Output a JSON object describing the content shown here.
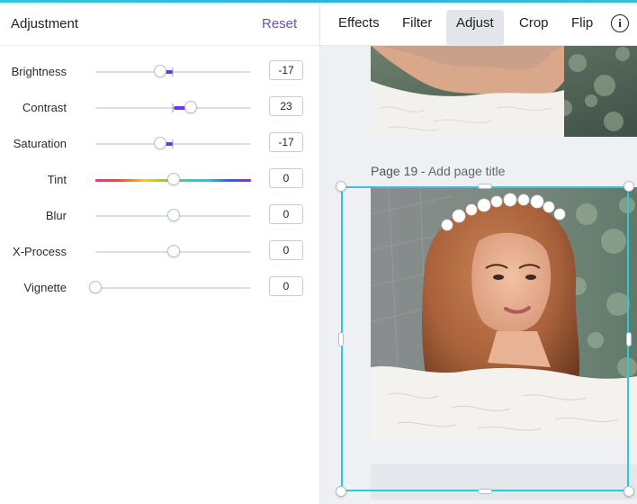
{
  "panel": {
    "title": "Adjustment",
    "reset_label": "Reset"
  },
  "adjustments": [
    {
      "label": "Brightness",
      "value": "-17",
      "fraction": 0.415,
      "type": "bipolar"
    },
    {
      "label": "Contrast",
      "value": "23",
      "fraction": 0.615,
      "type": "bipolar"
    },
    {
      "label": "Saturation",
      "value": "-17",
      "fraction": 0.415,
      "type": "bipolar"
    },
    {
      "label": "Tint",
      "value": "0",
      "fraction": 0.5,
      "type": "tint"
    },
    {
      "label": "Blur",
      "value": "0",
      "fraction": 0.5,
      "type": "plain"
    },
    {
      "label": "X-Process",
      "value": "0",
      "fraction": 0.5,
      "type": "plain"
    },
    {
      "label": "Vignette",
      "value": "0",
      "fraction": 0.0,
      "type": "plain"
    }
  ],
  "toolbar": {
    "effects": "Effects",
    "filter": "Filter",
    "adjust": "Adjust",
    "crop": "Crop",
    "flip": "Flip",
    "info_glyph": "i",
    "info_icon": "info-icon"
  },
  "page": {
    "caption_prefix": "Page 19 - ",
    "caption_action": "Add page title"
  },
  "colors": {
    "accent": "#6a3ce0",
    "selection": "#2ec9d6",
    "reset": "#6b4fbb"
  }
}
